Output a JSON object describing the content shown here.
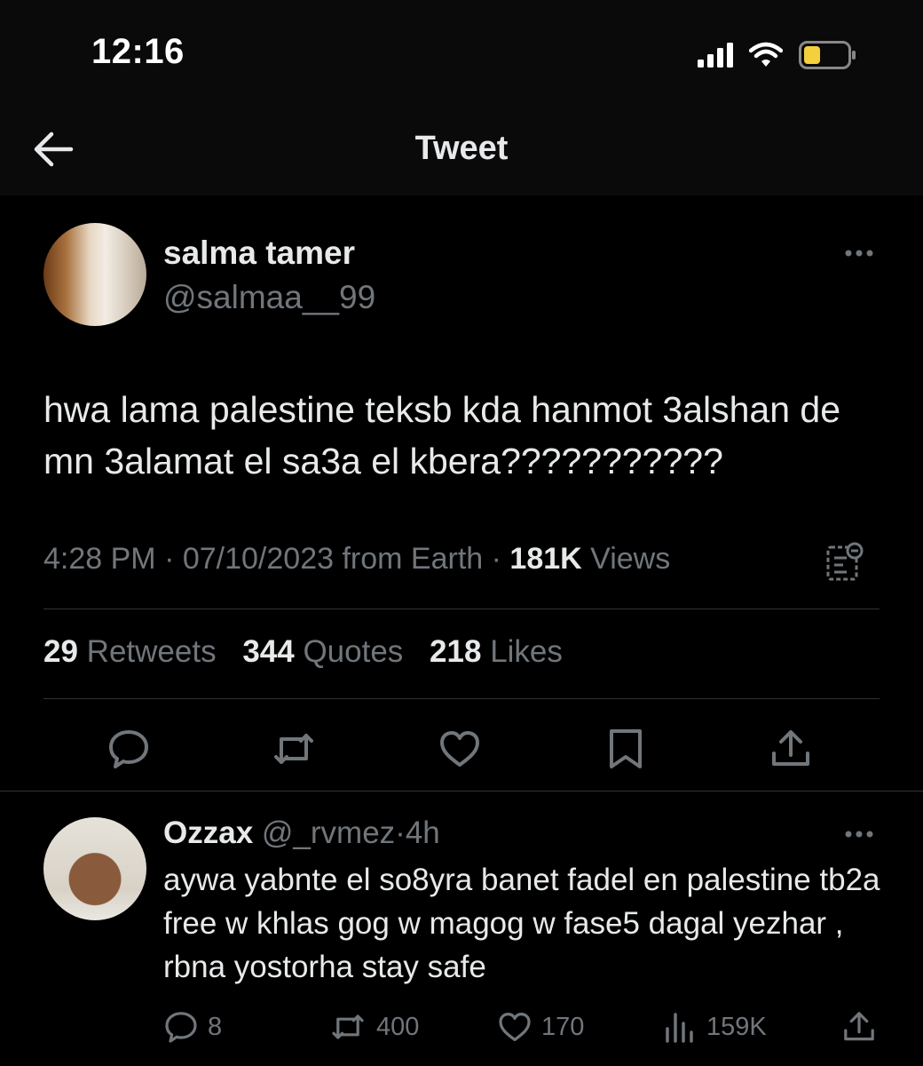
{
  "status_bar": {
    "time": "12:16",
    "battery_color": "#f4d03f"
  },
  "nav": {
    "title": "Tweet"
  },
  "tweet": {
    "author": {
      "name": "salma tamer",
      "handle": "@salmaa__99"
    },
    "text": "hwa lama palestine teksb kda hanmot 3alshan de mn 3alamat el sa3a el kbera???????????",
    "time": "4:28 PM",
    "date": "07/10/2023",
    "source": "from Earth",
    "views_count": "181K",
    "views_label": "Views",
    "stats": {
      "retweets_count": "29",
      "retweets_label": "Retweets",
      "quotes_count": "344",
      "quotes_label": "Quotes",
      "likes_count": "218",
      "likes_label": "Likes"
    }
  },
  "reply": {
    "author": {
      "name": "Ozzax",
      "handle": "@_rvmez"
    },
    "age": "4h",
    "text": "aywa yabnte el so8yra banet fadel en palestine tb2a free w khlas gog w magog w fase5 dagal yezhar , rbna yostorha stay safe",
    "replies": "8",
    "retweets": "400",
    "likes": "170",
    "views": "159K"
  },
  "icons": [
    "signal-icon",
    "wifi-icon",
    "battery-icon",
    "back-arrow-icon",
    "more-icon",
    "analytics-icon",
    "reply-icon",
    "retweet-icon",
    "like-icon",
    "bookmark-icon",
    "share-icon",
    "views-icon"
  ]
}
